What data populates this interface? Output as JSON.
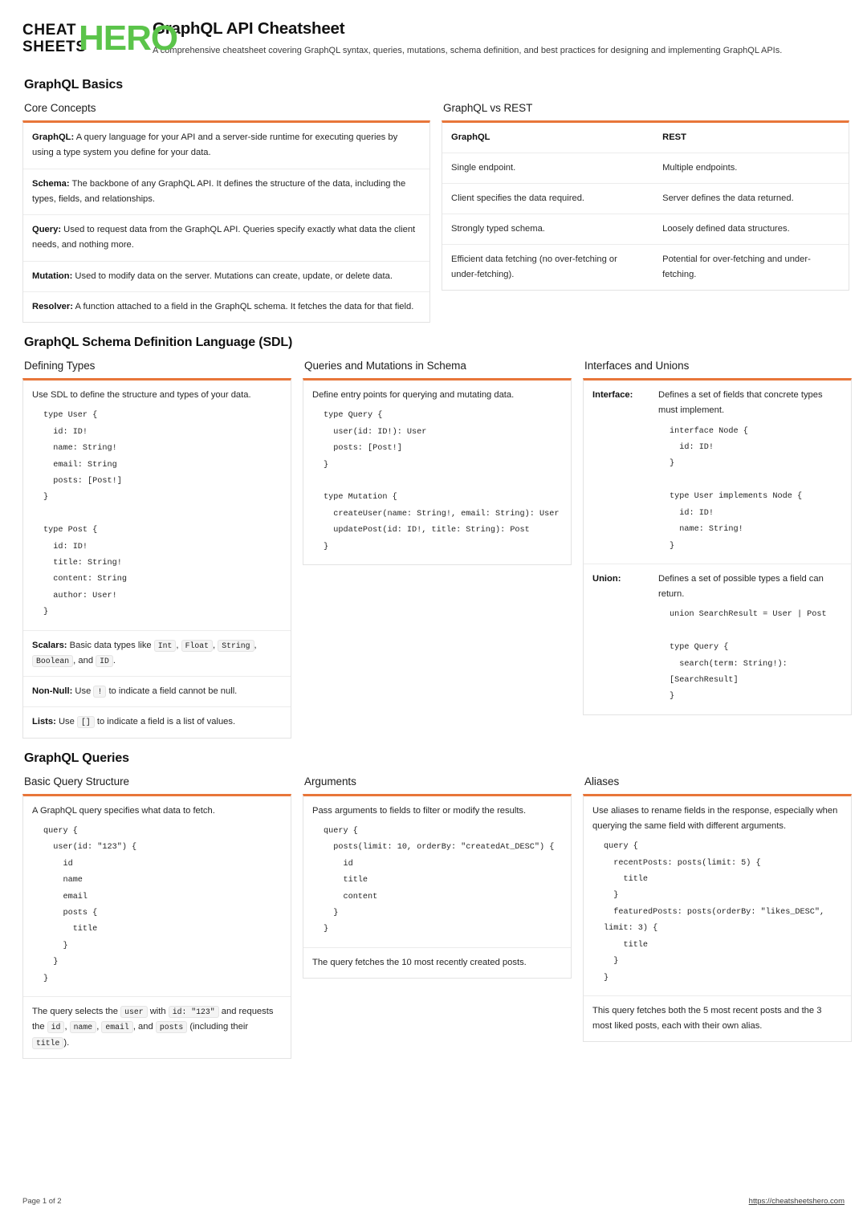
{
  "brand": {
    "logo_line1": "CHEAT",
    "logo_line2": "SHEETS",
    "logo_accent": "HERO",
    "accent_color": "#5BC44A",
    "rule_color": "#E8763A"
  },
  "header": {
    "title": "GraphQL API Cheatsheet",
    "subtitle": "A comprehensive cheatsheet covering GraphQL syntax, queries, mutations, schema definition, and best practices for designing and implementing GraphQL APIs."
  },
  "sections": {
    "basics": {
      "heading": "GraphQL Basics",
      "core_concepts": {
        "title": "Core Concepts",
        "items": [
          {
            "term": "GraphQL:",
            "desc": " A query language for your API and a server-side runtime for executing queries by using a type system you define for your data."
          },
          {
            "term": "Schema:",
            "desc": " The backbone of any GraphQL API. It defines the structure of the data, including the types, fields, and relationships."
          },
          {
            "term": "Query:",
            "desc": " Used to request data from the GraphQL API. Queries specify exactly what data the client needs, and nothing more."
          },
          {
            "term": "Mutation:",
            "desc": " Used to modify data on the server. Mutations can create, update, or delete data."
          },
          {
            "term": "Resolver:",
            "desc": " A function attached to a field in the GraphQL schema. It fetches the data for that field."
          }
        ]
      },
      "vs_rest": {
        "title": "GraphQL vs REST",
        "columns": [
          "GraphQL",
          "REST"
        ],
        "rows": [
          [
            "Single endpoint.",
            "Multiple endpoints."
          ],
          [
            "Client specifies the data required.",
            "Server defines the data returned."
          ],
          [
            "Strongly typed schema.",
            "Loosely defined data structures."
          ],
          [
            "Efficient data fetching (no over-fetching or under-fetching).",
            "Potential for over-fetching and under-fetching."
          ]
        ]
      }
    },
    "sdl": {
      "heading": "GraphQL Schema Definition Language (SDL)",
      "defining_types": {
        "title": "Defining Types",
        "intro": "Use SDL to define the structure and types of your data.",
        "code": "type User {\n  id: ID!\n  name: String!\n  email: String\n  posts: [Post!]\n}\n\ntype Post {\n  id: ID!\n  title: String!\n  content: String\n  author: User!\n}",
        "scalars_term": "Scalars:",
        "scalars_pre": " Basic data types like ",
        "scalars_chips": [
          "Int",
          "Float",
          "String",
          "Boolean",
          "ID"
        ],
        "scalars_sep1": ", ",
        "scalars_and": ", and ",
        "scalars_end": ".",
        "nonnull_term": "Non-Null:",
        "nonnull_pre": " Use ",
        "nonnull_chip": "!",
        "nonnull_post": " to indicate a field cannot be null.",
        "lists_term": "Lists:",
        "lists_pre": " Use ",
        "lists_chip": "[]",
        "lists_post": " to indicate a field is a list of values."
      },
      "queries_mutations": {
        "title": "Queries and Mutations in Schema",
        "intro": "Define entry points for querying and mutating data.",
        "code": "type Query {\n  user(id: ID!): User\n  posts: [Post!]\n}\n\ntype Mutation {\n  createUser(name: String!, email: String): User\n  updatePost(id: ID!, title: String): Post\n}"
      },
      "interfaces_unions": {
        "title": "Interfaces and Unions",
        "items": [
          {
            "term": "Interface:",
            "desc": "Defines a set of fields that concrete types must implement.",
            "code": "interface Node {\n  id: ID!\n}\n\ntype User implements Node {\n  id: ID!\n  name: String!\n}"
          },
          {
            "term": "Union:",
            "desc": "Defines a set of possible types a field can return.",
            "code": "union SearchResult = User | Post\n\ntype Query {\n  search(term: String!): [SearchResult]\n}"
          }
        ]
      }
    },
    "queries": {
      "heading": "GraphQL Queries",
      "basic_query": {
        "title": "Basic Query Structure",
        "intro": "A GraphQL query specifies what data to fetch.",
        "code": "query {\n  user(id: \"123\") {\n    id\n    name\n    email\n    posts {\n      title\n    }\n  }\n}",
        "note_pre": "The query selects the ",
        "note_chip1": "user",
        "note_mid1": " with ",
        "note_chip2": "id: \"123\"",
        "note_mid2": " and requests the ",
        "note_chip3": "id",
        "note_mid3": ", ",
        "note_chip4": "name",
        "note_mid4": ", ",
        "note_chip5": "email",
        "note_mid5": ", and ",
        "note_chip6": "posts",
        "note_mid6": " (including their ",
        "note_chip7": "title",
        "note_end": ")."
      },
      "arguments": {
        "title": "Arguments",
        "intro": "Pass arguments to fields to filter or modify the results.",
        "code": "query {\n  posts(limit: 10, orderBy: \"createdAt_DESC\") {\n    id\n    title\n    content\n  }\n}",
        "note": "The query fetches the 10 most recently created posts."
      },
      "aliases": {
        "title": "Aliases",
        "intro": "Use aliases to rename fields in the response, especially when querying the same field with different arguments.",
        "code": "query {\n  recentPosts: posts(limit: 5) {\n    title\n  }\n  featuredPosts: posts(orderBy: \"likes_DESC\", limit: 3) {\n    title\n  }\n}",
        "note": "This query fetches both the 5 most recent posts and the 3 most liked posts, each with their own alias."
      }
    }
  },
  "footer": {
    "page_label": "Page 1 of 2",
    "site_url": "https://cheatsheetshero.com"
  }
}
